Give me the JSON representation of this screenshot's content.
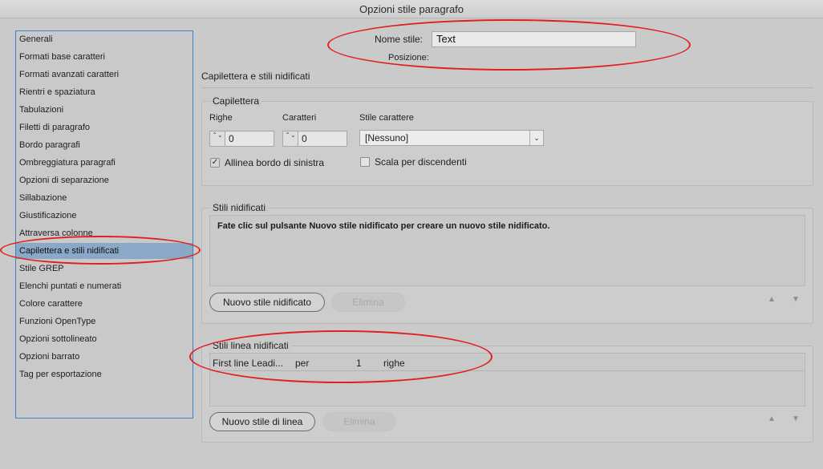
{
  "window": {
    "title": "Opzioni stile paragrafo"
  },
  "sidebar": {
    "items": [
      {
        "label": "Generali"
      },
      {
        "label": "Formati base caratteri"
      },
      {
        "label": "Formati avanzati caratteri"
      },
      {
        "label": "Rientri e spaziatura"
      },
      {
        "label": "Tabulazioni"
      },
      {
        "label": "Filetti di paragrafo"
      },
      {
        "label": "Bordo paragrafi"
      },
      {
        "label": "Ombreggiatura paragrafi"
      },
      {
        "label": "Opzioni di separazione"
      },
      {
        "label": "Sillabazione"
      },
      {
        "label": "Giustificazione"
      },
      {
        "label": "Attraversa colonne"
      },
      {
        "label": "Capilettera e stili nidificati"
      },
      {
        "label": "Stile GREP"
      },
      {
        "label": "Elenchi puntati e numerati"
      },
      {
        "label": "Colore carattere"
      },
      {
        "label": "Funzioni OpenType"
      },
      {
        "label": "Opzioni sottolineato"
      },
      {
        "label": "Opzioni barrato"
      },
      {
        "label": "Tag per esportazione"
      }
    ],
    "selected": "Capilettera e stili nidificati"
  },
  "header": {
    "style_name_label": "Nome stile:",
    "style_name_value": "Text",
    "position_label": "Posizione:"
  },
  "section": {
    "title": "Capilettera e stili nidificati"
  },
  "capilettera": {
    "title": "Capilettera",
    "righe_label": "Righe",
    "righe_value": "0",
    "caratteri_label": "Caratteri",
    "caratteri_value": "0",
    "stile_carattere_label": "Stile carattere",
    "stile_carattere_value": "[Nessuno]",
    "allinea_label": "Allinea bordo di sinistra",
    "allinea_checked": true,
    "scala_label": "Scala per discendenti",
    "scala_checked": false
  },
  "stili_nidificati": {
    "title": "Stili nidificati",
    "hint": "Fate clic sul pulsante Nuovo stile nidificato per creare un nuovo stile nidificato.",
    "new_button": "Nuovo stile nidificato",
    "delete_button": "Elimina"
  },
  "stili_linea": {
    "title": "Stili linea nidificati",
    "row": {
      "style": "First line Leadi...",
      "per": "per",
      "count": "1",
      "unit": "righe"
    },
    "new_button": "Nuovo stile di linea",
    "delete_button": "Elimina"
  },
  "icons": {
    "up": "▲",
    "down": "▼",
    "spinner": "⌃⌄",
    "dropdown": "⌄",
    "check": "✓"
  },
  "colors": {
    "highlight": "#e0201d",
    "selection": "#8aa9c8",
    "sidebar_border": "#3f7fd0"
  }
}
